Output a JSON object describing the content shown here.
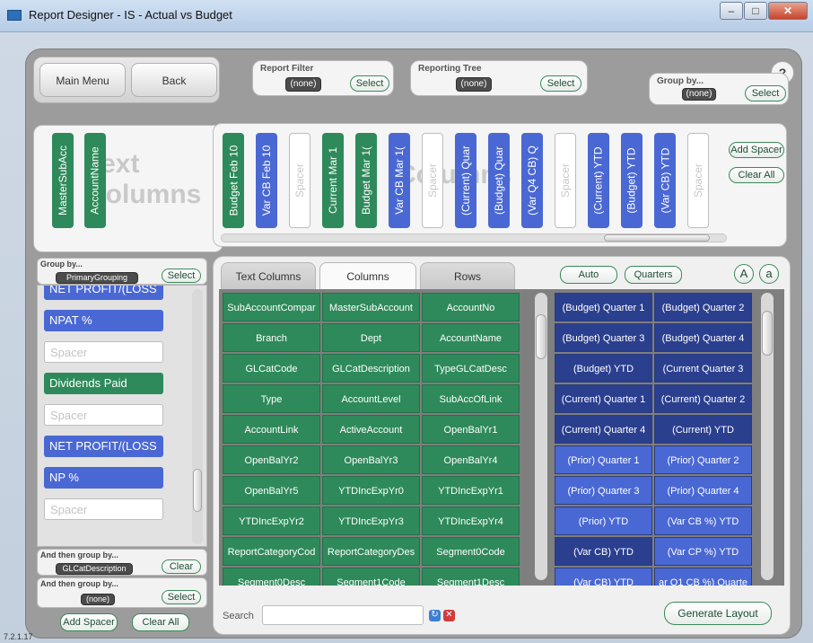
{
  "window": {
    "title": "Report Designer - IS - Actual vs Budget"
  },
  "nav": {
    "main_menu": "Main Menu",
    "back": "Back",
    "help": "?"
  },
  "report_filter": {
    "label": "Report Filter",
    "value": "(none)",
    "select": "Select"
  },
  "reporting_tree": {
    "label": "Reporting Tree",
    "value": "(none)",
    "select": "Select"
  },
  "top_group_by": {
    "label": "Group by...",
    "value": "(none)",
    "select": "Select"
  },
  "text_columns": {
    "watermark": "Text Columns",
    "chips": [
      {
        "label": "MasterSubAcc",
        "color": "#2e8a5a"
      },
      {
        "label": "AccountName",
        "color": "#2e8a5a"
      }
    ]
  },
  "columns_strip": {
    "watermark": "Columns",
    "chips": [
      {
        "label": "Budget Feb 10",
        "kind": "green"
      },
      {
        "label": "Var CB Feb 10",
        "kind": "blue"
      },
      {
        "label": "Spacer",
        "kind": "spacer"
      },
      {
        "label": "Current Mar 1",
        "kind": "green"
      },
      {
        "label": "Budget Mar 1(",
        "kind": "green"
      },
      {
        "label": "Var CB Mar 1(",
        "kind": "blue"
      },
      {
        "label": "Spacer",
        "kind": "spacer"
      },
      {
        "label": "(Current) Quar",
        "kind": "blue"
      },
      {
        "label": "(Budget) Quar",
        "kind": "blue"
      },
      {
        "label": "(Var Q4 CB) Q",
        "kind": "blue"
      },
      {
        "label": "Spacer",
        "kind": "spacer"
      },
      {
        "label": "(Current) YTD",
        "kind": "blue"
      },
      {
        "label": "(Budget) YTD",
        "kind": "blue"
      },
      {
        "label": "(Var CB) YTD",
        "kind": "blue"
      },
      {
        "label": "Spacer",
        "kind": "spacer"
      }
    ],
    "add_spacer": "Add Spacer",
    "clear_all": "Clear All"
  },
  "left_group": {
    "group_by_label": "Group by...",
    "group_by_value": "PrimaryGrouping",
    "group_by_select": "Select",
    "items": [
      {
        "label": "NET PROFIT/(LOSS",
        "kind": "blue"
      },
      {
        "label": "NPAT %",
        "kind": "blue"
      },
      {
        "label": "Spacer",
        "kind": "spacer"
      },
      {
        "label": "Dividends Paid",
        "kind": "green"
      },
      {
        "label": "Spacer",
        "kind": "spacer"
      },
      {
        "label": "NET PROFIT/(LOSS",
        "kind": "blue"
      },
      {
        "label": "NP %",
        "kind": "blue"
      },
      {
        "label": "Spacer",
        "kind": "spacer"
      }
    ],
    "then_group_label": "And then group by...",
    "then_group_value": "GLCatDescription",
    "then_group_clear": "Clear",
    "then_group2_label": "And then group by...",
    "then_group2_value": "(none)",
    "then_group2_select": "Select",
    "add_spacer": "Add Spacer",
    "clear_all": "Clear All"
  },
  "tabs": {
    "text_columns": "Text Columns",
    "columns": "Columns",
    "rows": "Rows"
  },
  "toolbar": {
    "auto": "Auto",
    "quarters": "Quarters",
    "upper_a": "A",
    "lower_a": "a"
  },
  "fields_grid": [
    [
      "SubAccountCompar",
      "MasterSubAccount",
      "AccountNo"
    ],
    [
      "Branch",
      "Dept",
      "AccountName"
    ],
    [
      "GLCatCode",
      "GLCatDescription",
      "TypeGLCatDesc"
    ],
    [
      "Type",
      "AccountLevel",
      "SubAccOfLink"
    ],
    [
      "AccountLink",
      "ActiveAccount",
      "OpenBalYr1"
    ],
    [
      "OpenBalYr2",
      "OpenBalYr3",
      "OpenBalYr4"
    ],
    [
      "OpenBalYr5",
      "YTDIncExpYr0",
      "YTDIncExpYr1"
    ],
    [
      "YTDIncExpYr2",
      "YTDIncExpYr3",
      "YTDIncExpYr4"
    ],
    [
      "ReportCategoryCod",
      "ReportCategoryDes",
      "Segment0Code"
    ],
    [
      "Segment0Desc",
      "Segment1Code",
      "Segment1Desc"
    ]
  ],
  "periods_grid": [
    [
      {
        "label": "(Budget) Quarter 1",
        "color": "#2b3f8f"
      },
      {
        "label": "(Budget) Quarter 2",
        "color": "#2b3f8f"
      }
    ],
    [
      {
        "label": "(Budget) Quarter 3",
        "color": "#2b3f8f"
      },
      {
        "label": "(Budget) Quarter 4",
        "color": "#2b3f8f"
      }
    ],
    [
      {
        "label": "(Budget) YTD",
        "color": "#2b3f8f"
      },
      {
        "label": "(Current Quarter 3",
        "color": "#2b3f8f"
      }
    ],
    [
      {
        "label": "(Current) Quarter 1",
        "color": "#2b3f8f"
      },
      {
        "label": "(Current) Quarter 2",
        "color": "#2b3f8f"
      }
    ],
    [
      {
        "label": "(Current) Quarter 4",
        "color": "#2b3f8f"
      },
      {
        "label": "(Current) YTD",
        "color": "#2b3f8f"
      }
    ],
    [
      {
        "label": "(Prior) Quarter 1",
        "color": "#4a68d4"
      },
      {
        "label": "(Prior) Quarter 2",
        "color": "#4a68d4"
      }
    ],
    [
      {
        "label": "(Prior) Quarter 3",
        "color": "#4a68d4"
      },
      {
        "label": "(Prior) Quarter 4",
        "color": "#4a68d4"
      }
    ],
    [
      {
        "label": "(Prior) YTD",
        "color": "#4a68d4"
      },
      {
        "label": "(Var CB %) YTD",
        "color": "#4a68d4"
      }
    ],
    [
      {
        "label": "(Var CB) YTD",
        "color": "#2b3f8f"
      },
      {
        "label": "(Var CP %) YTD",
        "color": "#4a68d4"
      }
    ],
    [
      {
        "label": "(Var CB) YTD",
        "color": "#4a68d4"
      },
      {
        "label": "ar Q1 CB %) Quarte",
        "color": "#4a68d4"
      }
    ]
  ],
  "search": {
    "label": "Search",
    "value": ""
  },
  "generate_layout": "Generate Layout",
  "version": "7.2.1.17"
}
